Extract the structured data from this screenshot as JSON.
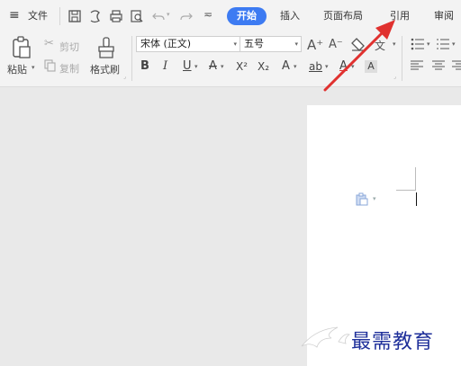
{
  "menubar": {
    "menu_icon_label": "≡",
    "file_label": "文件",
    "tabs": [
      {
        "label": "开始",
        "active": true
      },
      {
        "label": "插入"
      },
      {
        "label": "页面布局"
      },
      {
        "label": "引用"
      },
      {
        "label": "审阅"
      }
    ]
  },
  "ribbon": {
    "paste_label": "粘贴",
    "cut_label": "剪切",
    "copy_label": "复制",
    "format_painter_label": "格式刷",
    "font_name": "宋体 (正文)",
    "font_size": "五号",
    "bold": "B",
    "italic": "I",
    "underline": "U",
    "font_color_a": "A",
    "superscript": "X²",
    "subscript": "X₂",
    "clear_label": "A",
    "text_effect": "ab",
    "highlight": "A",
    "char_shading": "A",
    "grow_font": "A⁺",
    "shrink_font": "A⁻",
    "wen": "文"
  },
  "colors": {
    "accent": "#3d7bf2",
    "arrow": "#e0312f",
    "watermark": "#1e2f9a"
  },
  "watermark": {
    "text": "最需教育"
  }
}
